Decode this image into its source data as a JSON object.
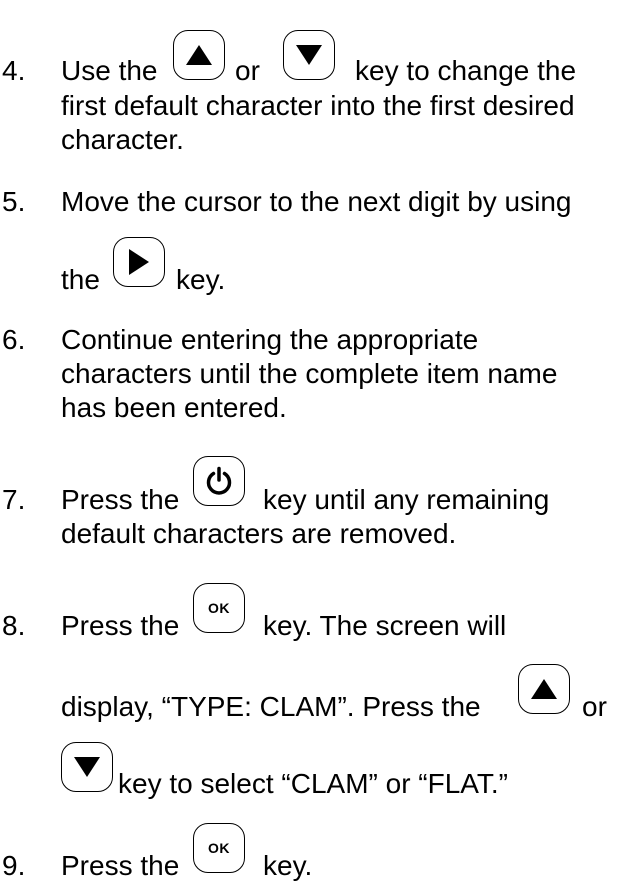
{
  "steps": [
    {
      "number": "4.",
      "text_a": "Use the",
      "text_b": "or",
      "text_c": "key to change the",
      "line2": "first default character into the first desired",
      "line3": "character."
    },
    {
      "number": "5.",
      "line1": "Move the cursor to the next digit by using",
      "text_a": "the",
      "text_b": "key."
    },
    {
      "number": "6.",
      "line1": "Continue entering the appropriate",
      "line2": "characters until the complete item name",
      "line3": "has been entered."
    },
    {
      "number": "7.",
      "text_a": "Press the",
      "text_b": "key until any remaining",
      "line2": "default characters are removed."
    },
    {
      "number": "8.",
      "text_a": "Press the",
      "text_b": "key. The screen will",
      "text_c": "display, “TYPE: CLAM”. Press the",
      "text_d": "or",
      "text_e": "key to select “CLAM” or “FLAT.”"
    },
    {
      "number": "9.",
      "text_a": "Press the",
      "text_b": "key."
    }
  ],
  "keys": {
    "up": "up-arrow",
    "down": "down-arrow",
    "right": "right-arrow",
    "power": "power",
    "ok_label": "OK"
  }
}
